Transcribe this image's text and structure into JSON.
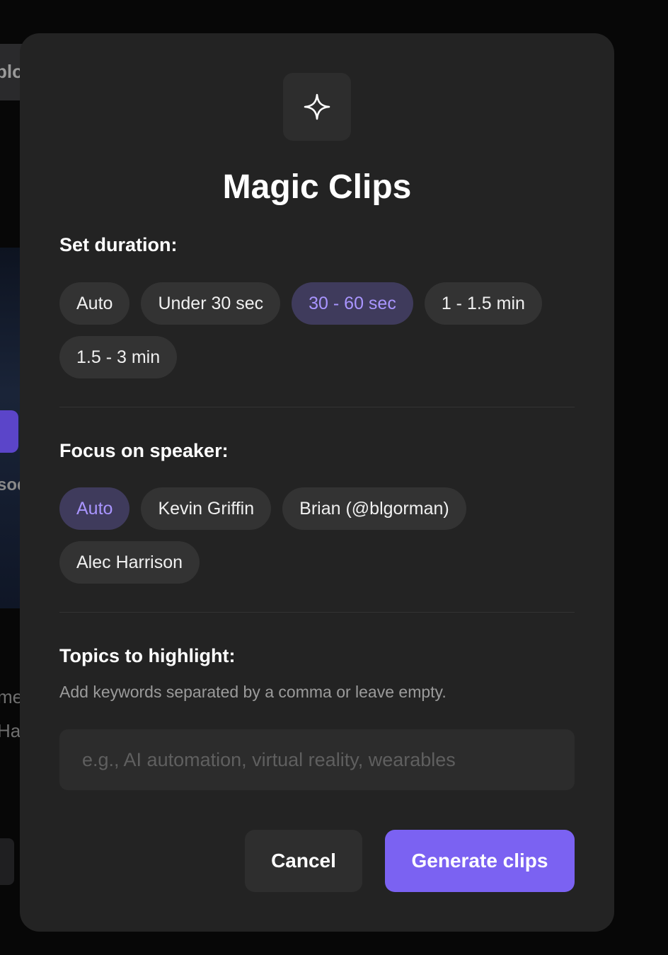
{
  "background": {
    "tab_fragment": "plo",
    "text_fragment_1": "sod",
    "text_fragment_2": "me",
    "text_fragment_3": "Ha"
  },
  "modal": {
    "icon": "sparkle-icon",
    "title": "Magic Clips",
    "duration": {
      "label": "Set duration:",
      "options": [
        "Auto",
        "Under 30 sec",
        "30 - 60 sec",
        "1 - 1.5 min",
        "1.5 - 3 min"
      ],
      "selected": "30 - 60 sec"
    },
    "speaker": {
      "label": "Focus on speaker:",
      "options": [
        "Auto",
        "Kevin Griffin",
        "Brian (@blgorman)",
        "Alec Harrison"
      ],
      "selected": "Auto"
    },
    "topics": {
      "label": "Topics to highlight:",
      "hint": "Add keywords separated by a comma or leave empty.",
      "value": "",
      "placeholder": "e.g., AI automation, virtual reality, wearables"
    },
    "cancel_label": "Cancel",
    "generate_label": "Generate clips"
  },
  "colors": {
    "accent": "#7b62f2",
    "selected_chip_bg": "#3f3b5c",
    "selected_chip_text": "#a995ff",
    "modal_bg": "#232323"
  }
}
